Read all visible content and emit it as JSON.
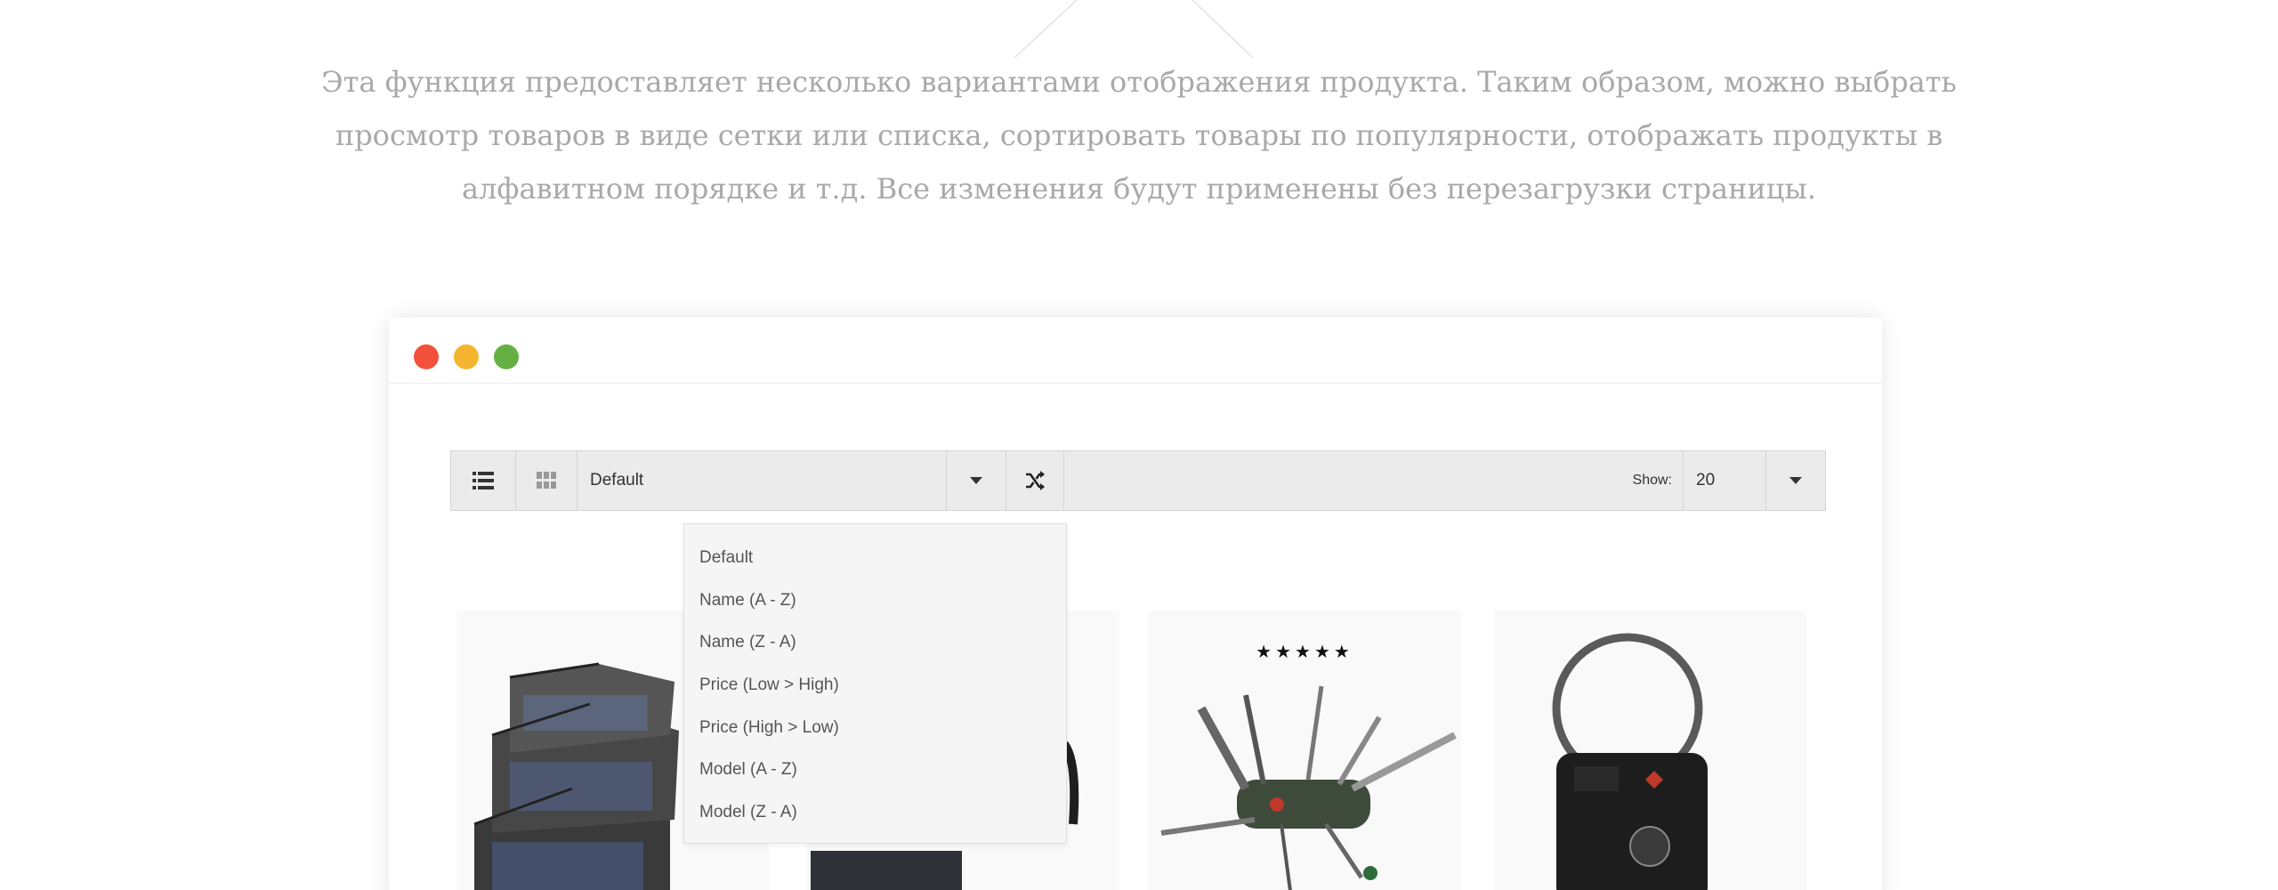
{
  "intro": {
    "line1": "Эта функция предоставляет несколько вариантами отображения продукта. Таким образом, можно выбрать",
    "line2": "просмотр товаров в виде сетки или списка, сортировать товары по популярности, отображать продукты в",
    "line3": "алфавитном порядке и т.д. Все изменения будут применены без перезагрузки страницы."
  },
  "window": {
    "controls": [
      "close",
      "minimize",
      "maximize"
    ],
    "colors": {
      "close": "#f4513a",
      "minimize": "#f6b531",
      "maximize": "#65b043"
    }
  },
  "toolbar": {
    "list_view_icon": "list-icon",
    "grid_view_icon": "grid-icon",
    "sort_selected": "Default",
    "sort_caret_icon": "caret-down-icon",
    "shuffle_icon": "shuffle-icon",
    "show_label": "Show:",
    "show_value": "20",
    "show_caret_icon": "caret-down-icon"
  },
  "sort_options": [
    "Default",
    "Name (A - Z)",
    "Name (Z - A)",
    "Price (Low > High)",
    "Price (High > Low)",
    "Model (A - Z)",
    "Model (Z - A)"
  ],
  "products": [
    {
      "image": "packing-cubes"
    },
    {
      "image": "dark-bag"
    },
    {
      "image": "multi-tool-knife",
      "rating": "★★★★★"
    },
    {
      "image": "tsa-cable-lock"
    }
  ]
}
